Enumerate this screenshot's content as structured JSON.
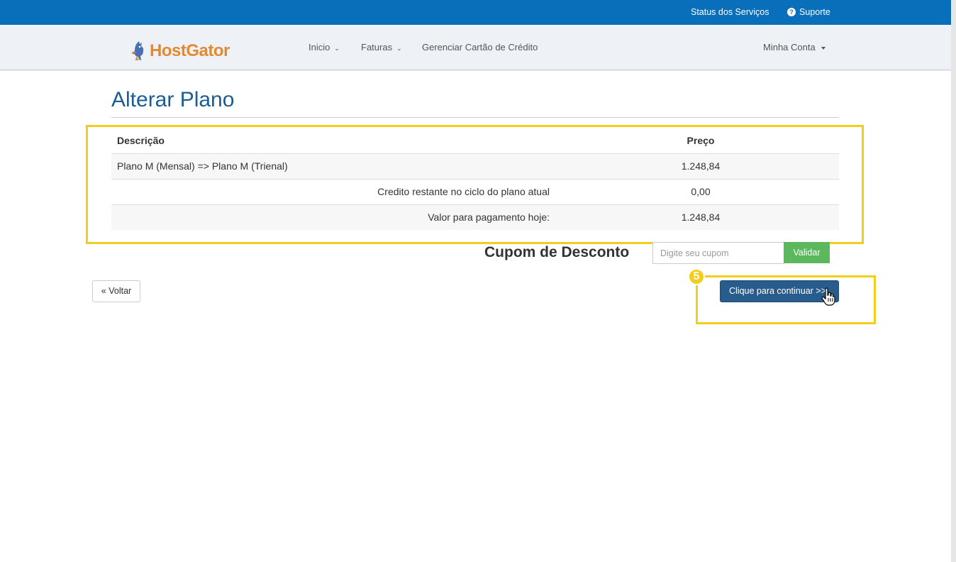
{
  "topbar": {
    "status_label": "Status dos Serviços",
    "support_label": "Suporte"
  },
  "navbar": {
    "logo_text": "HostGator",
    "items": [
      {
        "label": "Inicio"
      },
      {
        "label": "Faturas"
      },
      {
        "label": "Gerenciar Cartão de Crédito"
      }
    ],
    "account_label": "Minha Conta"
  },
  "page": {
    "title": "Alterar Plano"
  },
  "table": {
    "headers": {
      "description": "Descrição",
      "price": "Preço"
    },
    "rows": [
      {
        "description": "Plano M (Mensal) => Plano M (Trienal)",
        "price": "1.248,84"
      },
      {
        "description": "Credito restante no ciclo do plano atual",
        "price": "0,00"
      },
      {
        "description": "Valor para pagamento hoje:",
        "price": "1.248,84"
      }
    ]
  },
  "coupon": {
    "label": "Cupom de Desconto",
    "placeholder": "Digite seu cupom",
    "button": "Validar"
  },
  "actions": {
    "back_label": "« Voltar",
    "continue_label": "Clique para continuar >>",
    "step_number": "5"
  },
  "colors": {
    "topbar": "#0a6fba",
    "highlight": "#f2cd1b",
    "title": "#1a5c94",
    "primary_button": "#275c8c",
    "success_button": "#5cb85c"
  }
}
